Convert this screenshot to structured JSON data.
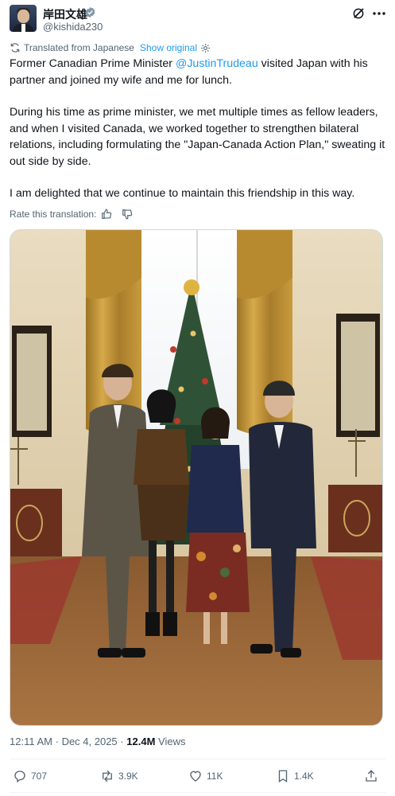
{
  "author": {
    "display_name": "岸田文雄",
    "handle": "@kishida230"
  },
  "translation": {
    "label": "Translated from Japanese",
    "show_original": "Show original",
    "rate_label": "Rate this translation:"
  },
  "tweet": {
    "para1_before": "Former Canadian Prime Minister ",
    "para1_mention": "@JustinTrudeau",
    "para1_after": " visited Japan with his partner and joined my wife and me for lunch.",
    "para2": "During his time as prime minister, we met multiple times as fellow leaders, and when I visited Canada, we worked together to strengthen bilateral relations, including formulating the \"Japan-Canada Action Plan,\" sweating it out side by side.",
    "para3": "I am delighted that we continue to maintain this friendship in this way."
  },
  "meta": {
    "time": "12:11 AM",
    "sep": "·",
    "date": "Dec 4, 2025",
    "views_count": "12.4M",
    "views_label": "Views"
  },
  "actions": {
    "replies": "707",
    "reposts": "3.9K",
    "likes": "11K",
    "bookmarks": "1.4K"
  },
  "icons": [
    "verified-badge-icon",
    "grok-icon",
    "more-icon",
    "translate-icon",
    "settings-icon",
    "thumbs-up-icon",
    "thumbs-down-icon",
    "reply-icon",
    "repost-icon",
    "like-icon",
    "bookmark-icon",
    "share-icon"
  ],
  "colors": {
    "link": "#1d9bf0",
    "secondary_text": "#536471",
    "primary_text": "#0f1419"
  }
}
